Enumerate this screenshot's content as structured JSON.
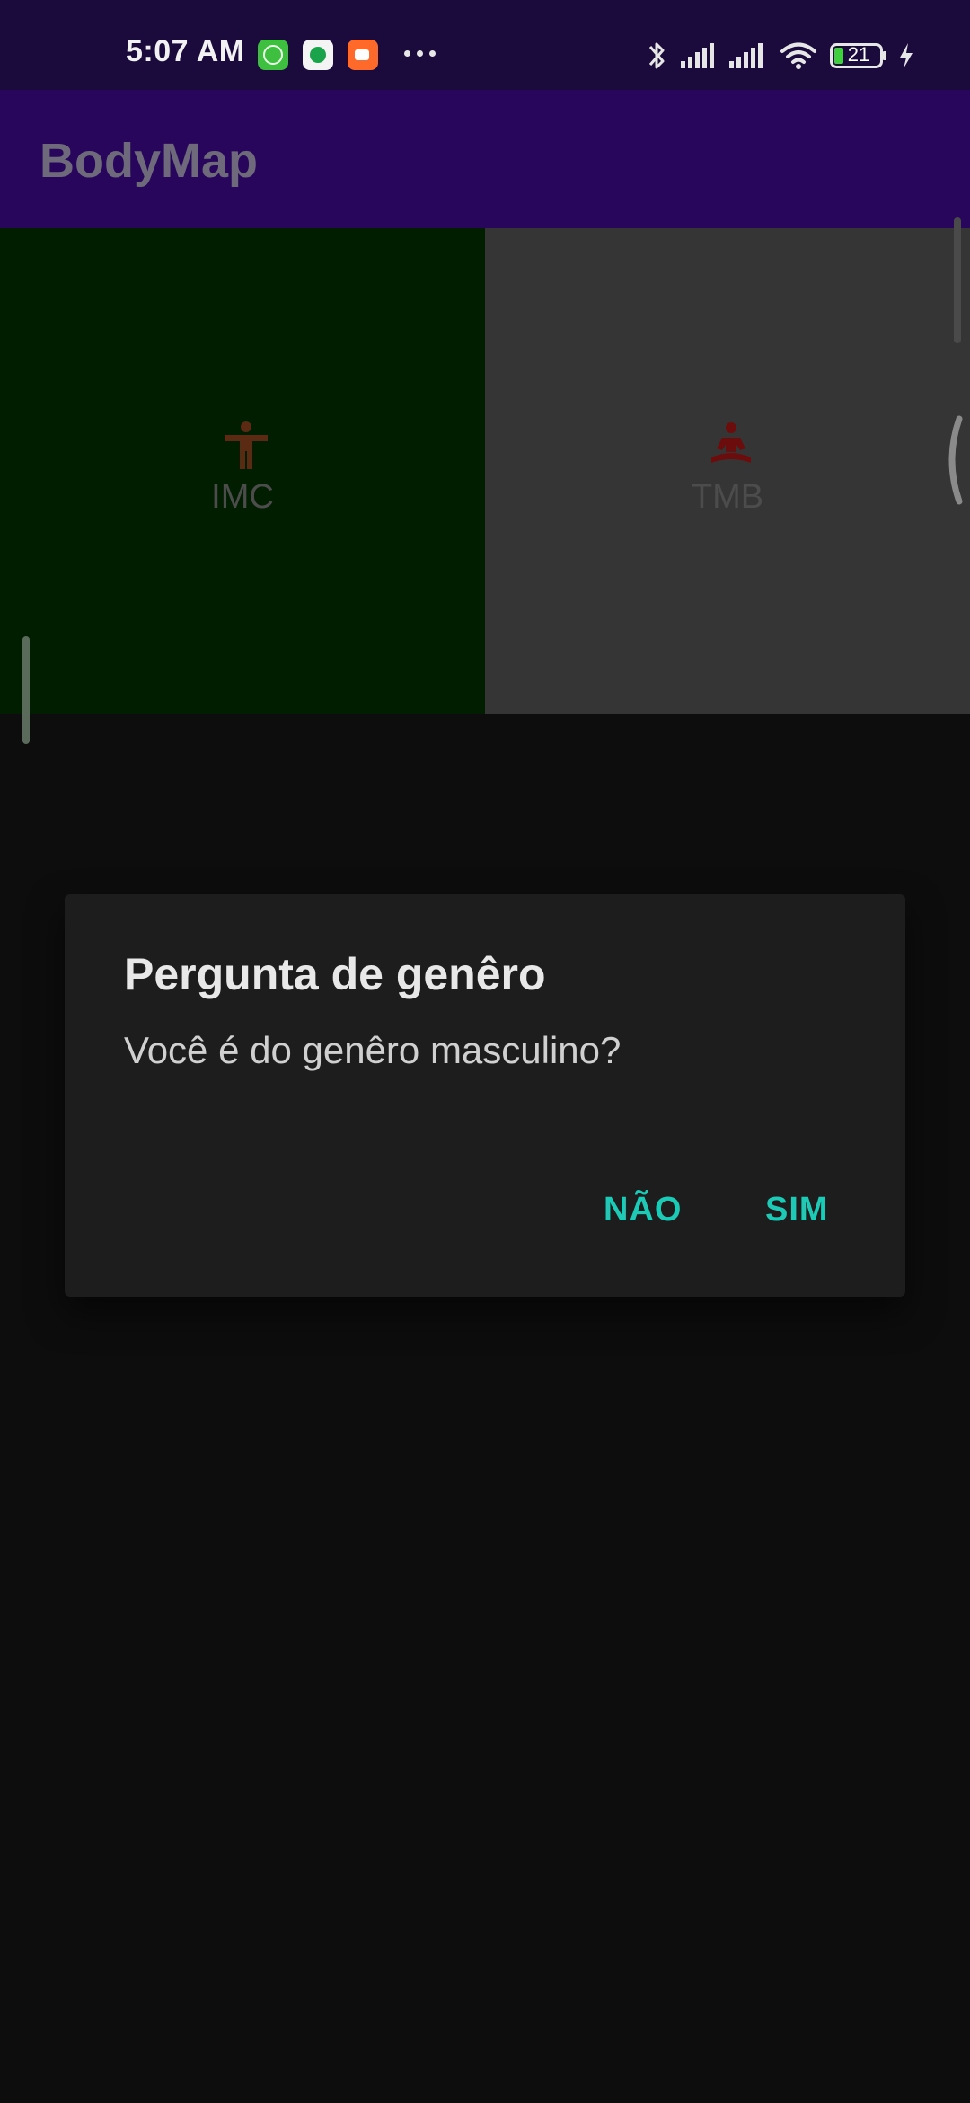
{
  "status_bar": {
    "time": "5:07 AM",
    "notification_icons": [
      "cat-app-icon",
      "k-app-icon",
      "video-call-icon"
    ],
    "battery_level": "21",
    "icons": [
      "bluetooth-icon",
      "signal-icon",
      "signal-icon",
      "wifi-icon",
      "battery-icon",
      "charging-icon"
    ]
  },
  "app_bar": {
    "title": "BodyMap"
  },
  "grid": {
    "tiles": [
      {
        "label": "IMC",
        "icon": "accessibility-person-icon",
        "background": "#011f00",
        "icon_color": "#5a2a12"
      },
      {
        "label": "TMB",
        "icon": "meditation-icon",
        "background": "#353535",
        "icon_color": "#6b0d0d"
      }
    ]
  },
  "dialog": {
    "title": "Pergunta de genêro",
    "message": "Você é do genêro masculino?",
    "buttons": {
      "no": "NÃO",
      "yes": "SIM"
    },
    "accent_color": "#1ec9b6"
  },
  "colors": {
    "status_bar": "#1b0b3c",
    "app_bar": "#28065c",
    "background": "#0d0d0d",
    "dialog": "#1d1d1d"
  }
}
